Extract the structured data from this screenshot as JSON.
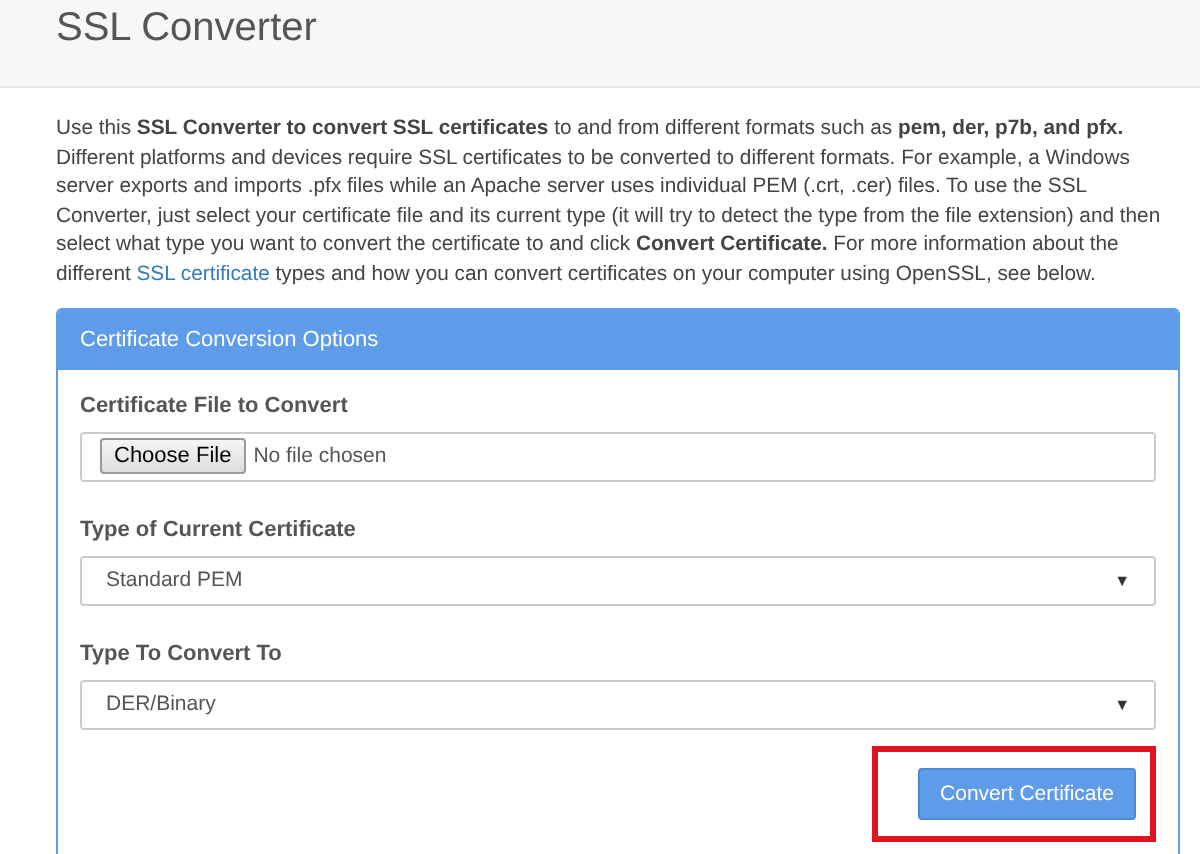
{
  "page_title": "SSL Converter",
  "intro": {
    "before": "Use this **SSL Converter to convert SSL certificates** to and from different formats such as **pem, der, p7b, and pfx.** Different platforms and devices require SSL certificates to be converted to different formats. For example, a Windows server exports and imports .pfx files while an Apache server uses individual PEM (.crt, .cer) files. To use the SSL Converter, just select your certificate file and its current type (it will try to detect the type from the file extension) and then select what type you want to convert the certificate to and click **Convert Certificate.** For more information about the different ",
    "link": "SSL certificate",
    "after": " types and how you can convert certificates on your computer using OpenSSL, see below."
  },
  "panel": {
    "title": "Certificate Conversion Options",
    "fields": [
      {
        "kind": "file",
        "label": "Certificate File to Convert",
        "button": "Choose File",
        "status": "No file chosen"
      },
      {
        "kind": "select",
        "label": "Type of Current Certificate",
        "value": "Standard PEM",
        "arrow": "▼"
      },
      {
        "kind": "select",
        "label": "Type To Convert To",
        "value": "DER/Binary",
        "arrow": "▼"
      }
    ],
    "submit": {
      "label": "Convert Certificate",
      "highlighted": true
    }
  }
}
